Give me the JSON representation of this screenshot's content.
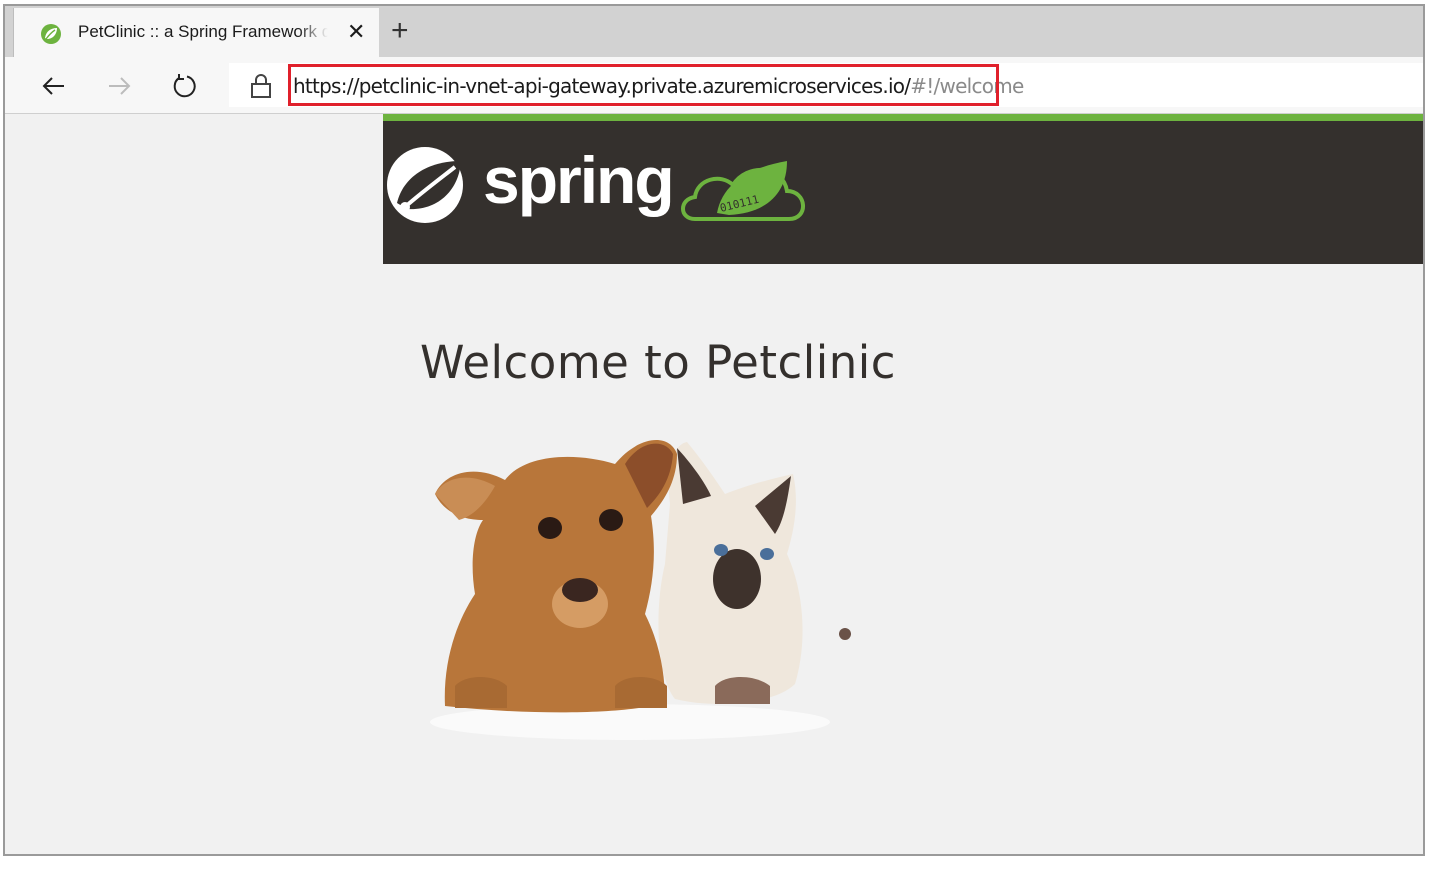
{
  "browser": {
    "tab": {
      "title": "PetClinic :: a Spring Framework demonstration",
      "favicon": "spring-leaf-icon"
    },
    "new_tab_icon": "plus-icon",
    "close_icon": "close-icon",
    "nav": {
      "back": "arrow-left-icon",
      "forward": "arrow-right-icon",
      "refresh": "refresh-icon"
    },
    "address": {
      "lock_icon": "lock-icon",
      "url_main": "https://petclinic-in-vnet-api-gateway.private.azuremicroservices.io/",
      "url_rest": "#!/welcome"
    }
  },
  "header": {
    "logo_text": "spring",
    "cloud_digits": "010111",
    "accent_color": "#6db33f",
    "bg_color": "#34302d"
  },
  "page": {
    "title": "Welcome to Petclinic",
    "image": "puppy-and-kitten-photo"
  },
  "annotation": {
    "color": "#e0202b"
  }
}
